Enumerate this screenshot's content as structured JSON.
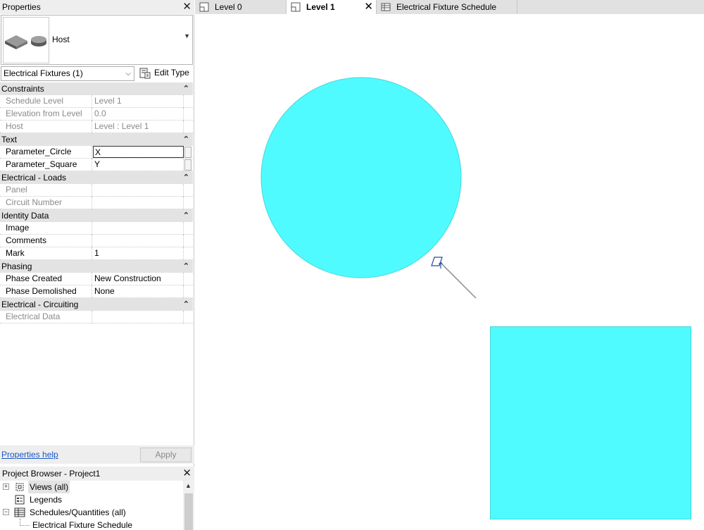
{
  "properties_panel": {
    "title": "Properties",
    "type_name": "Host",
    "instance_filter": "Electrical Fixtures (1)",
    "edit_type_label": "Edit Type",
    "groups": [
      {
        "name": "Constraints",
        "rows": [
          {
            "key": "Schedule Level",
            "value": "Level 1",
            "readonly": true
          },
          {
            "key": "Elevation from Level",
            "value": "0.0",
            "readonly": true
          },
          {
            "key": "Host",
            "value": "Level : Level 1",
            "readonly": true
          }
        ]
      },
      {
        "name": "Text",
        "rows": [
          {
            "key": "Parameter_Circle",
            "value": "X",
            "readonly": false,
            "editing": true
          },
          {
            "key": "Parameter_Square",
            "value": "Y",
            "readonly": false
          }
        ]
      },
      {
        "name": "Electrical - Loads",
        "rows": [
          {
            "key": "Panel",
            "value": "",
            "readonly": true
          },
          {
            "key": "Circuit Number",
            "value": "",
            "readonly": true
          }
        ]
      },
      {
        "name": "Identity Data",
        "rows": [
          {
            "key": "Image",
            "value": "",
            "readonly": false
          },
          {
            "key": "Comments",
            "value": "",
            "readonly": false
          },
          {
            "key": "Mark",
            "value": "1",
            "readonly": false
          }
        ]
      },
      {
        "name": "Phasing",
        "rows": [
          {
            "key": "Phase Created",
            "value": "New Construction",
            "readonly": false
          },
          {
            "key": "Phase Demolished",
            "value": "None",
            "readonly": false
          }
        ]
      },
      {
        "name": "Electrical - Circuiting",
        "rows": [
          {
            "key": "Electrical Data",
            "value": "",
            "readonly": true
          }
        ]
      }
    ],
    "help_link": "Properties help",
    "apply_label": "Apply"
  },
  "project_browser": {
    "title": "Project Browser - Project1",
    "items": [
      {
        "label": "Views (all)"
      },
      {
        "label": "Legends"
      },
      {
        "label": "Schedules/Quantities (all)"
      },
      {
        "label": "Electrical Fixture Schedule"
      }
    ]
  },
  "tabs": [
    {
      "label": "Level 0",
      "active": false
    },
    {
      "label": "Level 1",
      "active": true
    },
    {
      "label": "Electrical Fixture Schedule",
      "active": false
    }
  ],
  "canvas": {
    "fill_color": "#4ffbff",
    "outline_color": "#4ad6dc",
    "leader_color": "#8c8c8c",
    "anchor_color": "#1f4fa0"
  }
}
